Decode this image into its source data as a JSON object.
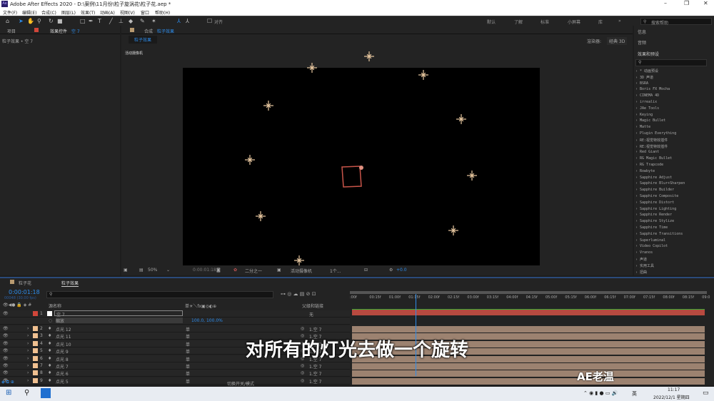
{
  "window": {
    "title": "Adobe After Effects 2020 - D:\\案例\\11月份\\粒子旋涡花\\粒子花.aep *",
    "app_icon": "Ae",
    "minimize": "–",
    "maximize": "❐",
    "close": "✕"
  },
  "menu": [
    "文件(F)",
    "编辑(E)",
    "合成(C)",
    "图层(L)",
    "效果(T)",
    "动画(A)",
    "视图(V)",
    "窗口",
    "帮助(H)"
  ],
  "toolbar": {
    "snap_label": "对齐",
    "workspaces": [
      "默认",
      "了解",
      "标准",
      "小屏幕",
      "库"
    ],
    "more": "»",
    "search_placeholder": "搜索帮助"
  },
  "left_panel": {
    "tab_project": "项目",
    "tab_effects": "效果控件",
    "tab_effects_layer": "空 7",
    "breadcrumb": "粒子效果 • 空 7"
  },
  "comp_panel": {
    "tab_label": "合成",
    "tab_comp": "粒子效果",
    "subtab": "粒子效果",
    "renderer_label": "渲染器:",
    "renderer_value": "经典 3D",
    "camera_label": "活动摄像机"
  },
  "comp_toolbar": {
    "zoom": "50%",
    "timecode": "0:00:01:18",
    "resolution": "二分之一",
    "camera": "活动摄像机",
    "views": "1个...",
    "exposure": "+0.0"
  },
  "right_panel": {
    "info": "信息",
    "audio": "音频",
    "effects_presets": "效果和预设",
    "effects": [
      "* 动画预设",
      "3D 声道",
      "BSRA",
      "Boris FX Mocha",
      "CINEMA 4D",
      "irrealix",
      "JAe Tools",
      "Keying",
      "Magic Bullet",
      "Matte",
      "Plugin Everything",
      "RE:视觉特效插件",
      "RE:视觉特效插件",
      "Red Giant",
      "RG Magic Bullet",
      "RG Trapcode",
      "Rowbyte",
      "Sapphire Adjust",
      "Sapphire Blur+Sharpen",
      "Sapphire Builder",
      "Sapphire Composite",
      "Sapphire Distort",
      "Sapphire Lighting",
      "Sapphire Render",
      "Sapphire Stylize",
      "Sapphire Time",
      "Sapphire Transitions",
      "Superluminal",
      "Video Copilot",
      "Vranos",
      "声道",
      "实用工具",
      "扭曲"
    ]
  },
  "timeline": {
    "tabs": [
      "粒子花",
      "粒子效果"
    ],
    "timecode": "0:00:01:18",
    "frames": "00048 (30.00 fps)",
    "col_source": "源名称",
    "col_switches": "单☀＼fx▣◎◐⊕",
    "col_parent": "父级和链接",
    "footer": "切换开关/模式",
    "ruler": [
      ":00f",
      "00:15f",
      "01:00f",
      "01:15f",
      "02:00f",
      "02:15f",
      "03:00f",
      "03:15f",
      "04:00f",
      "04:15f",
      "05:00f",
      "05:15f",
      "06:00f",
      "06:15f",
      "07:00f",
      "07:15f",
      "08:00f",
      "08:15f",
      "09:0"
    ],
    "playhead_fraction": 0.18,
    "null_layer": {
      "num": "1",
      "name": "空 7",
      "parent": "无",
      "transform": "缩放",
      "scale": "100.0, 100.0%"
    },
    "layers": [
      {
        "num": "2",
        "name": "点光 12",
        "parent": "1.空 7"
      },
      {
        "num": "3",
        "name": "点光 11",
        "parent": "1.空 7"
      },
      {
        "num": "4",
        "name": "点光 10",
        "parent": "1.空 7"
      },
      {
        "num": "5",
        "name": "点光 9",
        "parent": "1.空 7"
      },
      {
        "num": "6",
        "name": "点光 8",
        "parent": "1.空 7"
      },
      {
        "num": "7",
        "name": "点光 7",
        "parent": "1.空 7"
      },
      {
        "num": "8",
        "name": "点光 6",
        "parent": "1.空 7"
      },
      {
        "num": "9",
        "name": "点光 5",
        "parent": "1.空 7"
      }
    ],
    "colors": {
      "null_label": "#d0463a",
      "light_label": "#f0c090",
      "null_track": "#b84a40",
      "light_track": "#9c8270",
      "accent": "#2d8ceb"
    }
  },
  "subtitle": "对所有的灯光去做一个旋转",
  "watermark": "AE老温",
  "taskbar": {
    "time": "11:17",
    "date": "2022/12/1 星期四",
    "ime": "英"
  }
}
